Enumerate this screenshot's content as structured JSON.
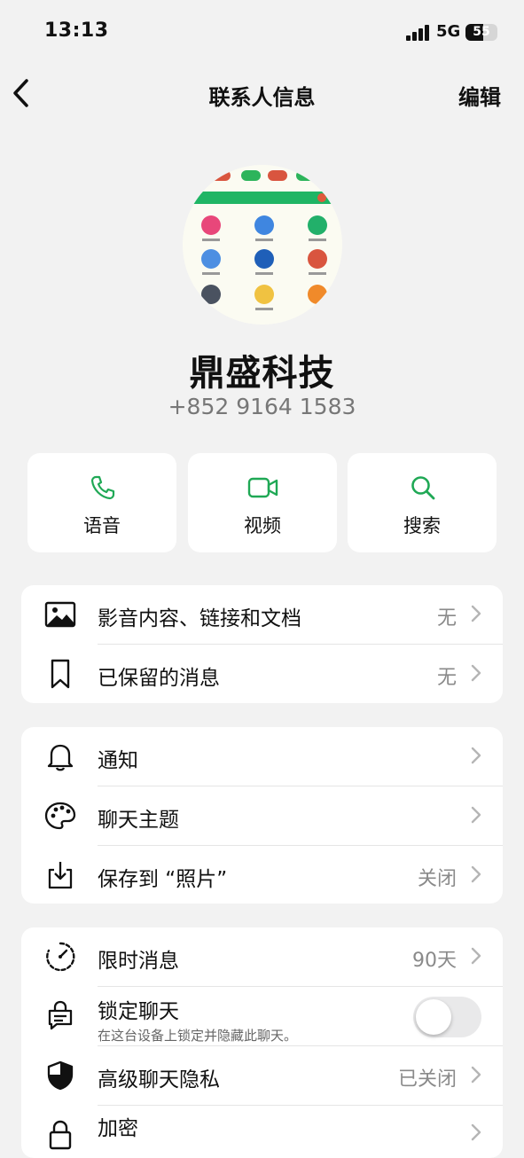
{
  "status_bar": {
    "time": "13:13",
    "network": "5G",
    "battery": "55"
  },
  "nav": {
    "title": "联系人信息",
    "edit_label": "编辑"
  },
  "contact": {
    "name": "鼎盛科技",
    "phone": "+852 9164 1583"
  },
  "actions": [
    {
      "label": "语音",
      "icon": "phone-icon"
    },
    {
      "label": "视频",
      "icon": "video-icon"
    },
    {
      "label": "搜索",
      "icon": "search-icon"
    }
  ],
  "section1": [
    {
      "label": "影音内容、链接和文档",
      "value": "无",
      "icon": "image-icon"
    },
    {
      "label": "已保留的消息",
      "value": "无",
      "icon": "bookmark-icon"
    }
  ],
  "section2": [
    {
      "label": "通知",
      "value": "",
      "icon": "bell-icon"
    },
    {
      "label": "聊天主题",
      "value": "",
      "icon": "palette-icon"
    },
    {
      "label": "保存到 “照片”",
      "value": "关闭",
      "icon": "download-icon"
    }
  ],
  "section3": [
    {
      "label": "限时消息",
      "value": "90天",
      "icon": "timer-icon"
    },
    {
      "label": "锁定聊天",
      "subtitle": "在这台设备上锁定并隐藏此聊天。",
      "toggle": false,
      "icon": "lock-chat-icon"
    },
    {
      "label": "高级聊天隐私",
      "value": "已关闭",
      "icon": "shield-icon"
    },
    {
      "label": "加密",
      "value": "",
      "icon": "lock-icon"
    }
  ],
  "colors": {
    "accent": "#1fa855",
    "background": "#f2f2f2",
    "card": "#ffffff"
  }
}
